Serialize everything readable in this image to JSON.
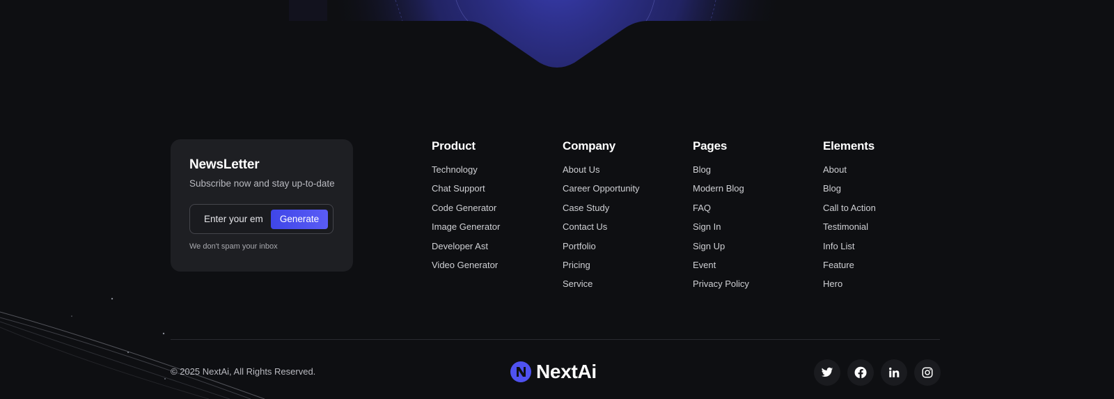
{
  "newsletter": {
    "title": "NewsLetter",
    "subtitle": "Subscribe now and stay up-to-date",
    "email_placeholder": "Enter your email",
    "button_label": "Generate",
    "note": "We don't spam your inbox"
  },
  "columns": [
    {
      "title": "Product",
      "links": [
        "Technology",
        "Chat Support",
        "Code Generator",
        "Image Generator",
        "Developer Ast",
        "Video Generator"
      ]
    },
    {
      "title": "Company",
      "links": [
        "About Us",
        "Career Opportunity",
        "Case Study",
        "Contact Us",
        "Portfolio",
        "Pricing",
        "Service"
      ]
    },
    {
      "title": "Pages",
      "links": [
        "Blog",
        "Modern Blog",
        "FAQ",
        "Sign In",
        "Sign Up",
        "Event",
        "Privacy Policy"
      ]
    },
    {
      "title": "Elements",
      "links": [
        "About",
        "Blog",
        "Call to Action",
        "Testimonial",
        "Info List",
        "Feature",
        "Hero"
      ]
    }
  ],
  "footer": {
    "copyright": "© 2025 NextAi, All Rights Reserved.",
    "brand_name": "NextAi",
    "social_icons": [
      "twitter-icon",
      "facebook-icon",
      "linkedin-icon",
      "instagram-icon"
    ]
  },
  "colors": {
    "background": "#0e0f12",
    "card": "#1e1f23",
    "accent": "#4f52f0",
    "glow": "#3b3fb8"
  }
}
